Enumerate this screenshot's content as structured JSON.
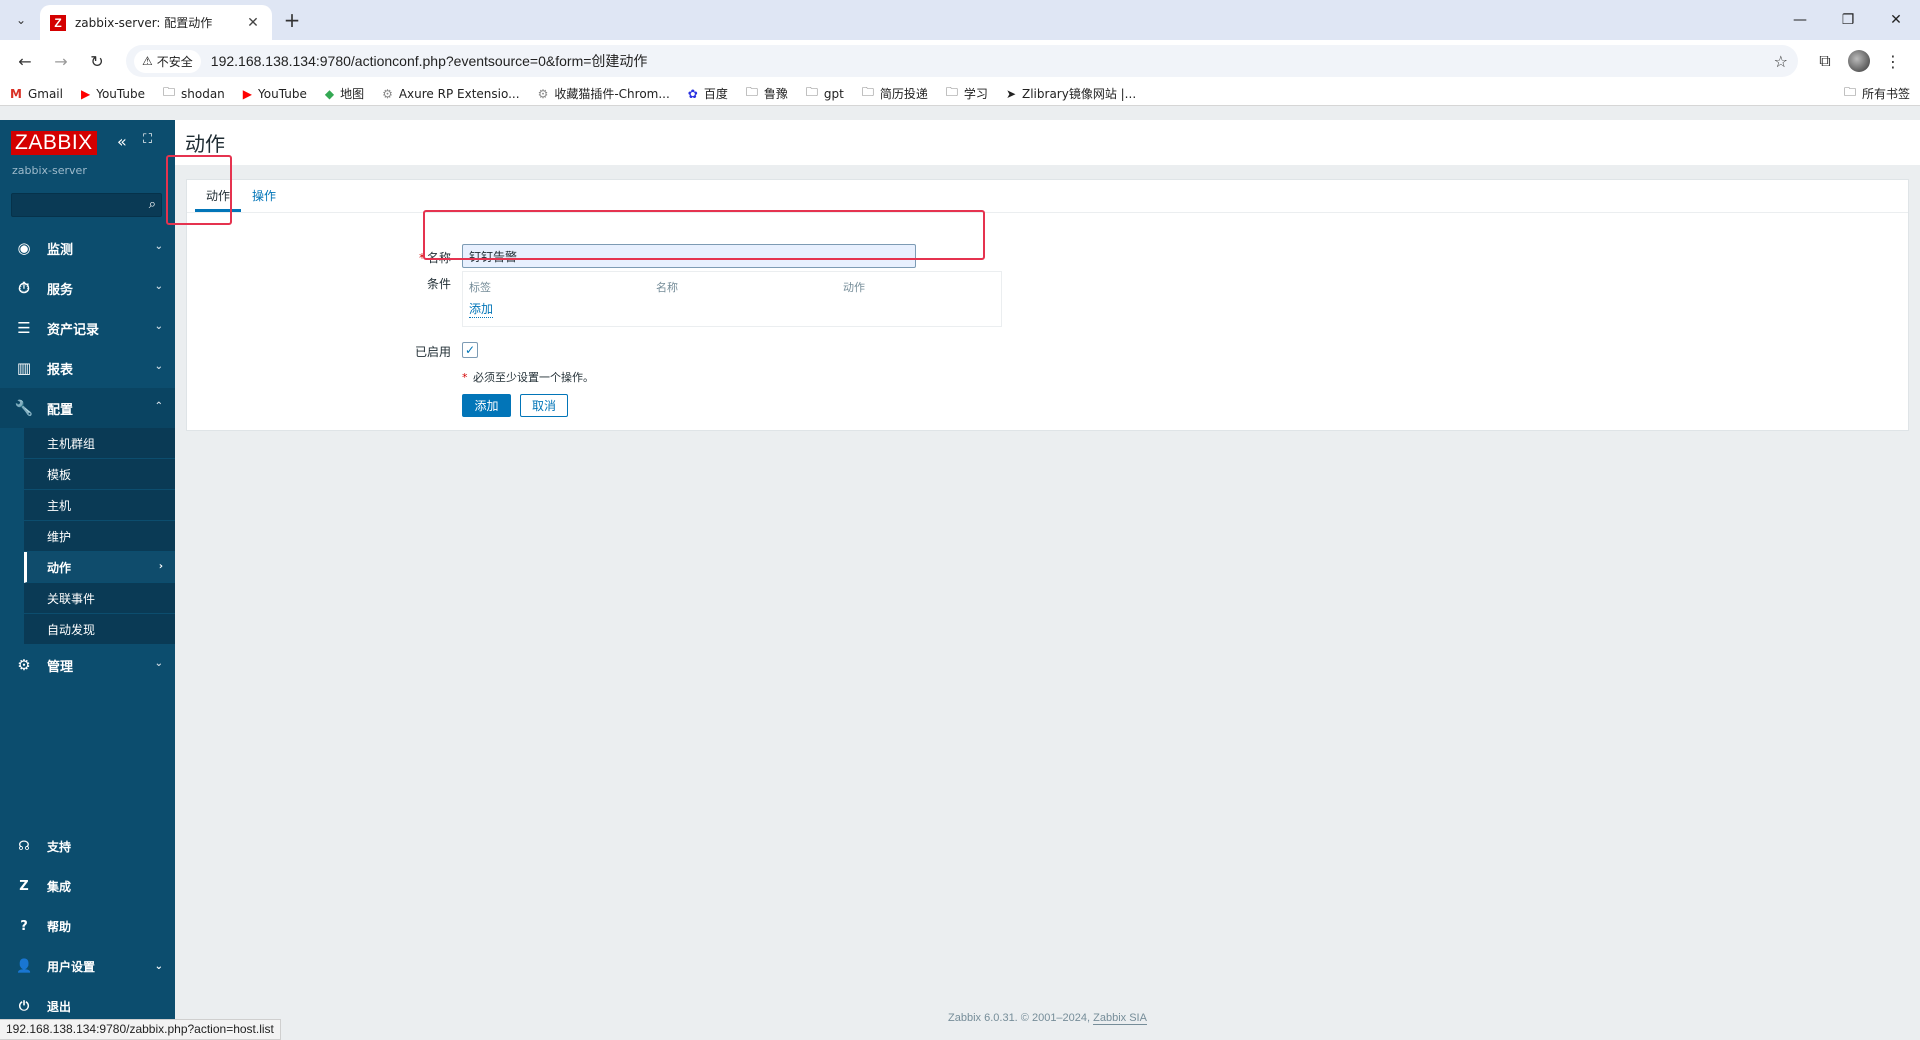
{
  "browser": {
    "tab_title": "zabbix-server: 配置动作",
    "tab_favicon": "Z",
    "security_label": "不安全",
    "url": "192.168.138.134:9780/actionconf.php?eventsource=0&form=创建动作",
    "bookmarks": [
      {
        "label": "Gmail",
        "icon": "gmail-icon"
      },
      {
        "label": "YouTube",
        "icon": "youtube-icon"
      },
      {
        "label": "shodan",
        "icon": "folder-icon"
      },
      {
        "label": "YouTube",
        "icon": "youtube-icon"
      },
      {
        "label": "地图",
        "icon": "maps-icon"
      },
      {
        "label": "Axure RP Extensio...",
        "icon": "extension-icon"
      },
      {
        "label": "收藏猫插件-Chrom...",
        "icon": "extension-icon"
      },
      {
        "label": "百度",
        "icon": "baidu-icon"
      },
      {
        "label": "鲁豫",
        "icon": "folder-icon"
      },
      {
        "label": "gpt",
        "icon": "folder-icon"
      },
      {
        "label": "简历投递",
        "icon": "folder-icon"
      },
      {
        "label": "学习",
        "icon": "folder-icon"
      },
      {
        "label": "Zlibrary镜像网站 |...",
        "icon": "send-icon"
      }
    ],
    "all_bookmarks": "所有书签",
    "status_url": "192.168.138.134:9780/zabbix.php?action=host.list"
  },
  "sidebar": {
    "logo": "ZABBIX",
    "server": "zabbix-server",
    "menu": [
      {
        "label": "监测",
        "icon": "eye-icon"
      },
      {
        "label": "服务",
        "icon": "clock-icon"
      },
      {
        "label": "资产记录",
        "icon": "list-icon"
      },
      {
        "label": "报表",
        "icon": "chart-icon"
      },
      {
        "label": "配置",
        "icon": "wrench-icon"
      }
    ],
    "config_submenu": [
      "主机群组",
      "模板",
      "主机",
      "维护",
      "动作",
      "关联事件",
      "自动发现"
    ],
    "admin": "管理",
    "bottom": [
      {
        "label": "支持",
        "icon": "headset-icon"
      },
      {
        "label": "集成",
        "icon": "zabbix-z-icon"
      },
      {
        "label": "帮助",
        "icon": "question-icon"
      },
      {
        "label": "用户设置",
        "icon": "user-icon"
      },
      {
        "label": "退出",
        "icon": "power-icon"
      }
    ]
  },
  "page": {
    "title": "动作",
    "tabs": [
      "动作",
      "操作"
    ],
    "name_label": "名称",
    "name_value": "钉钉告警",
    "conditions_label": "条件",
    "cond_headers": [
      "标签",
      "名称",
      "动作"
    ],
    "cond_add": "添加",
    "enabled_label": "已启用",
    "required_note": "必须至少设置一个操作。",
    "add_button": "添加",
    "cancel_button": "取消"
  },
  "footer": {
    "text": "Zabbix 6.0.31. © 2001–2024,",
    "link": "Zabbix SIA"
  }
}
